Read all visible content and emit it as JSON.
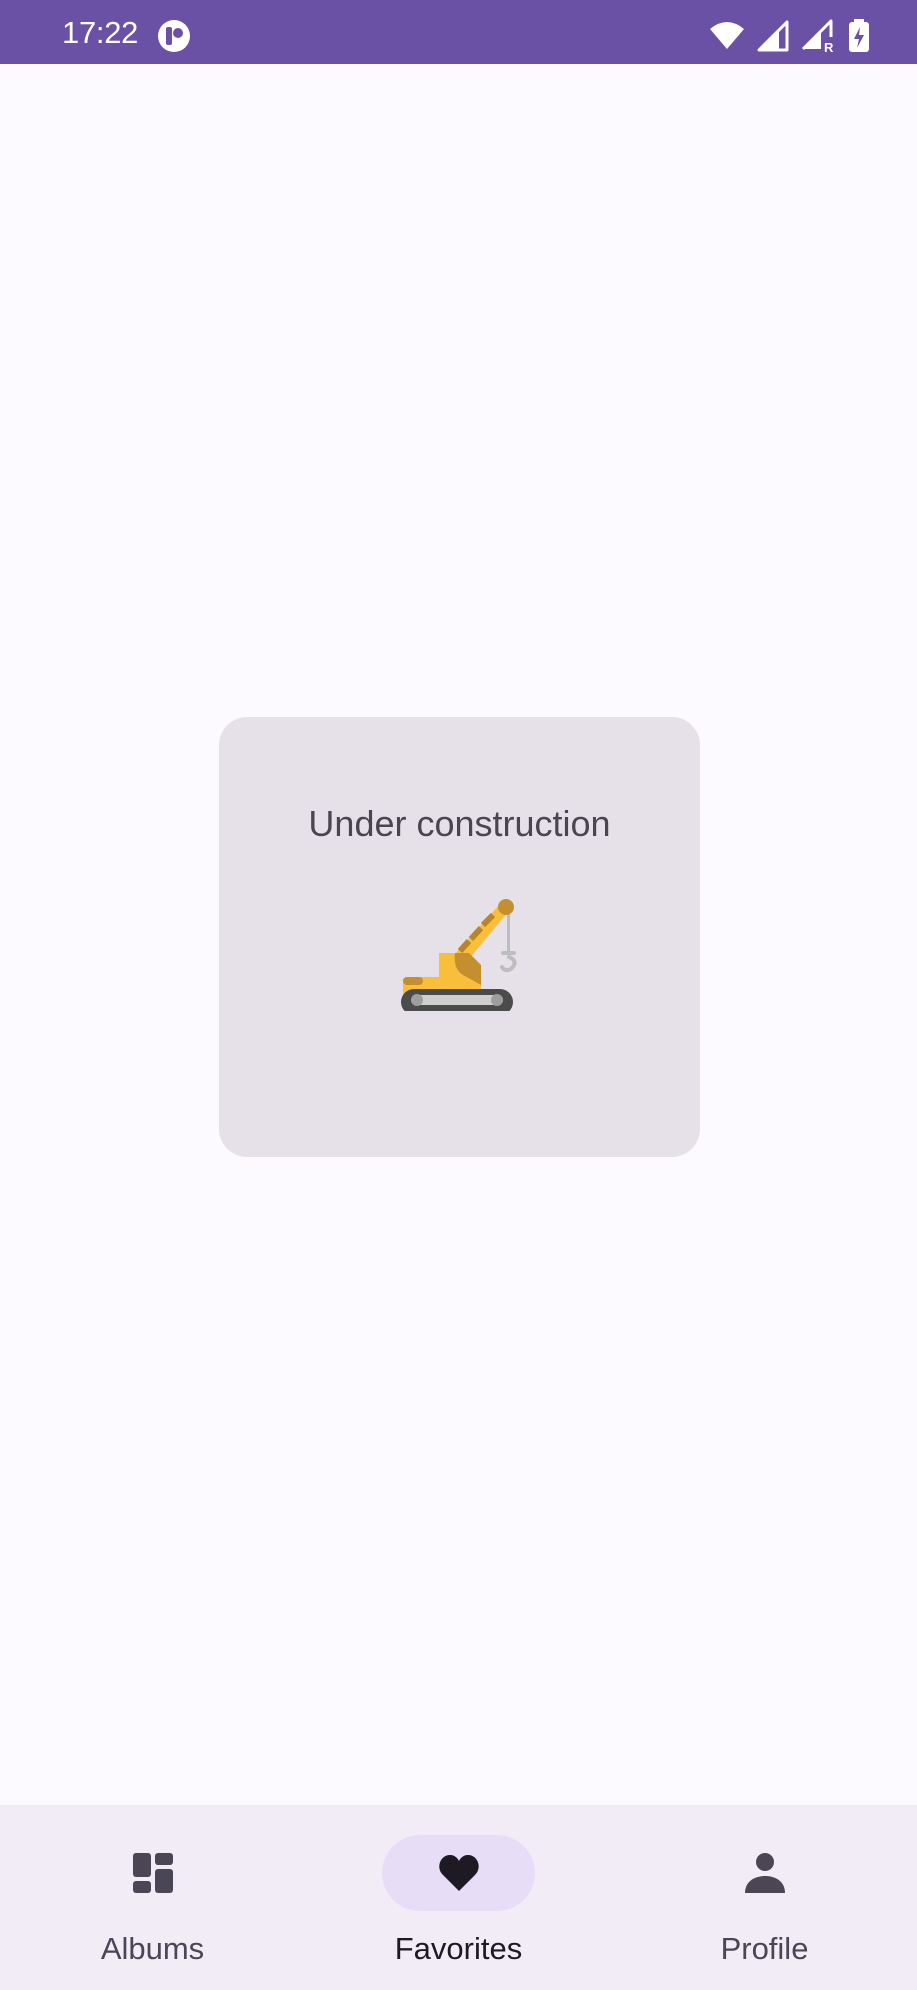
{
  "status_bar": {
    "time": "17:22",
    "app_icon": "notification-app-icon",
    "icons": [
      "wifi-icon",
      "signal-icon",
      "signal-roaming-icon",
      "battery-charging-icon"
    ],
    "roaming_indicator": "R",
    "color": "#6a51a6"
  },
  "main": {
    "card": {
      "title": "Under construction",
      "illustration": "crane-icon"
    }
  },
  "bottom_nav": {
    "items": [
      {
        "label": "Albums",
        "icon": "dashboard-icon",
        "selected": false
      },
      {
        "label": "Favorites",
        "icon": "heart-icon",
        "selected": true
      },
      {
        "label": "Profile",
        "icon": "person-icon",
        "selected": false
      }
    ],
    "indicator_color": "#e7ddf7",
    "background": "#f2ecf7"
  }
}
